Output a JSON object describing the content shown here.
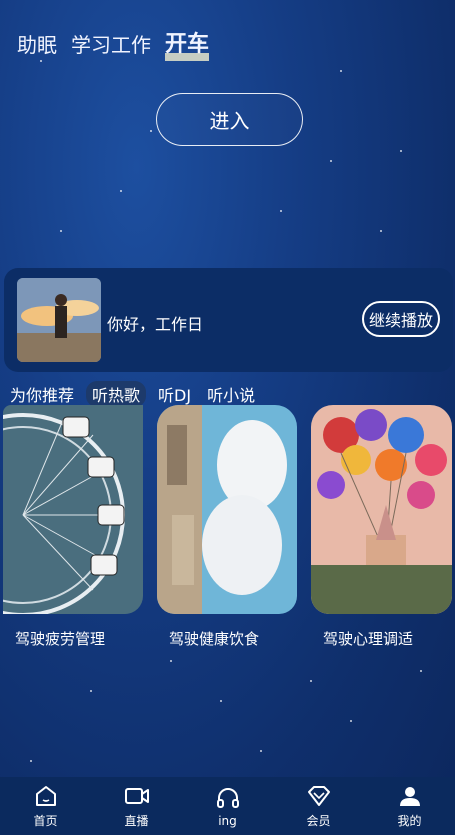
{
  "top_tabs": [
    {
      "label": "助眠"
    },
    {
      "label": "学习工作"
    },
    {
      "label": "开车"
    }
  ],
  "enter_label": "进入",
  "player": {
    "title": "你好，工作日",
    "continue_label": "继续播放"
  },
  "categories": [
    {
      "label": "为你推荐"
    },
    {
      "label": "听热歌"
    },
    {
      "label": "听DJ"
    },
    {
      "label": "听小说"
    }
  ],
  "cards": [
    {
      "label": "驾驶疲劳管理"
    },
    {
      "label": "驾驶健康饮食"
    },
    {
      "label": "驾驶心理调适"
    }
  ],
  "nav": [
    {
      "label": "首页",
      "icon": "home-icon"
    },
    {
      "label": "直播",
      "icon": "video-camera-icon"
    },
    {
      "label": "ing",
      "icon": "headphones-icon"
    },
    {
      "label": "会员",
      "icon": "diamond-icon"
    },
    {
      "label": "我的",
      "icon": "user-icon"
    }
  ],
  "colors": {
    "background": "#153d85",
    "card": "#0c2d66",
    "nav": "#0b2a5e"
  }
}
